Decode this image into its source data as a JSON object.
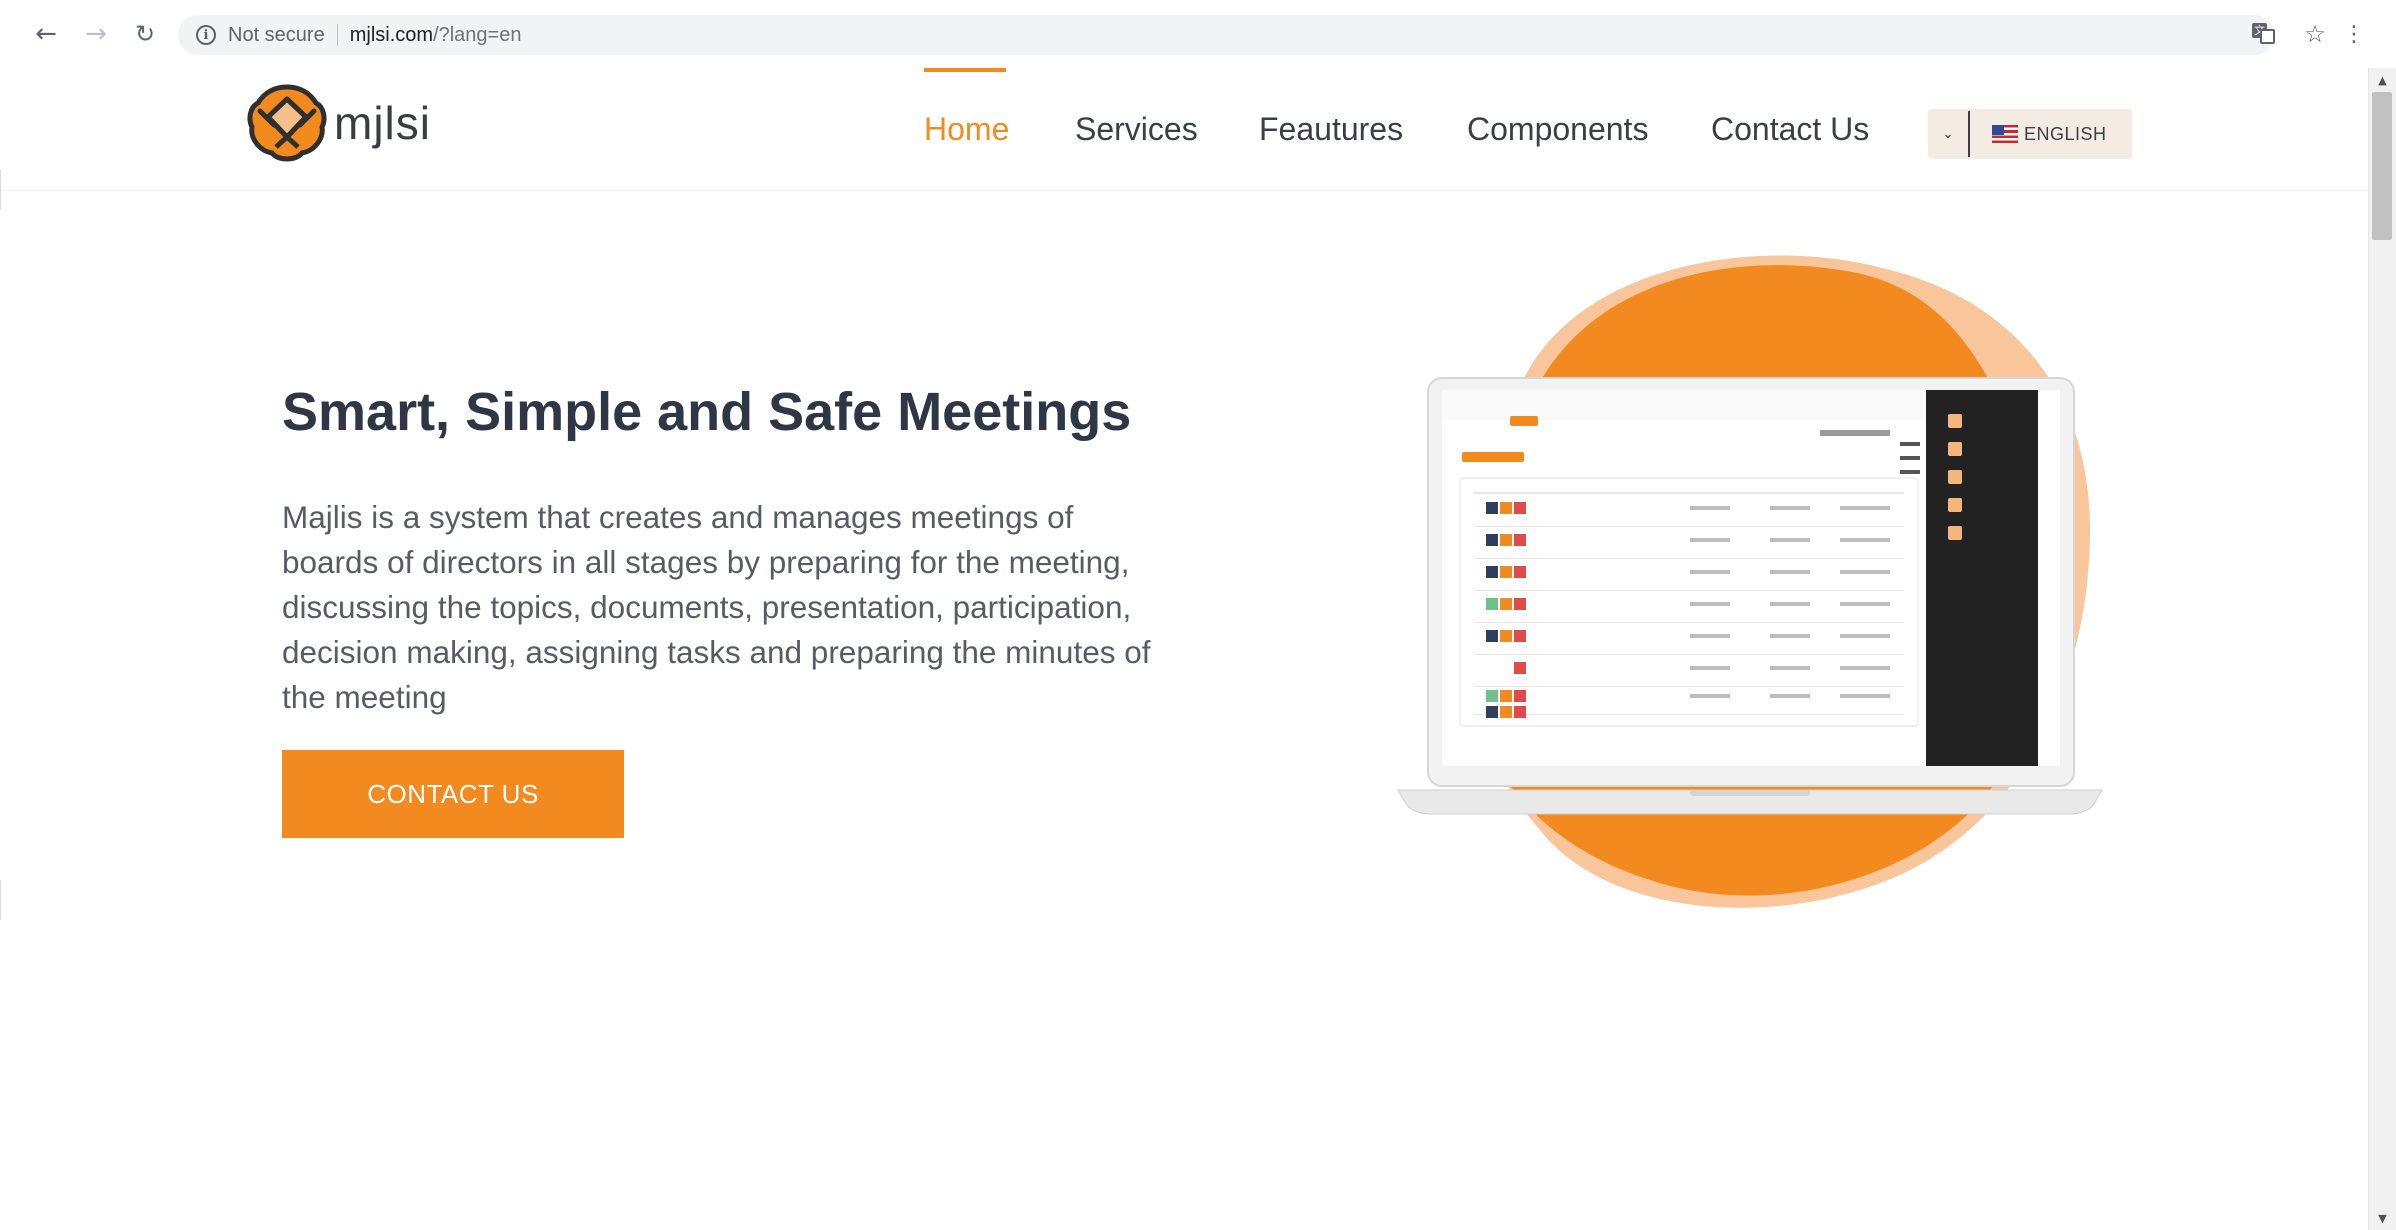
{
  "browser": {
    "security_label": "Not secure",
    "url_host": "mjlsi.com",
    "url_path": "/?lang=en",
    "back_icon": "arrow-left-icon",
    "forward_icon": "arrow-right-icon",
    "reload_icon": "reload-icon",
    "translate_icon": "translate-icon",
    "bookmark_icon": "star-icon",
    "menu_icon": "kebab-menu-icon"
  },
  "header": {
    "logo_text": "mjlsi",
    "nav": {
      "home": "Home",
      "services": "Services",
      "features": "Feautures",
      "components": "Components",
      "contact": "Contact Us"
    },
    "language": {
      "selected": "ENGLISH",
      "caret": "⌄"
    }
  },
  "hero": {
    "title": "Smart, Simple and Safe Meetings",
    "description": "Majlis is a system that creates and manages meetings of boards of directors in all stages by preparing for the meeting, discussing the topics, documents, presentation, participation, decision making, assigning tasks and preparing the minutes of the meeting",
    "cta_label": "CONTACT US"
  },
  "colors": {
    "accent": "#f28a1f",
    "heading": "#2f3745",
    "body_text": "#575c64",
    "language_bg": "#f4ece3"
  }
}
